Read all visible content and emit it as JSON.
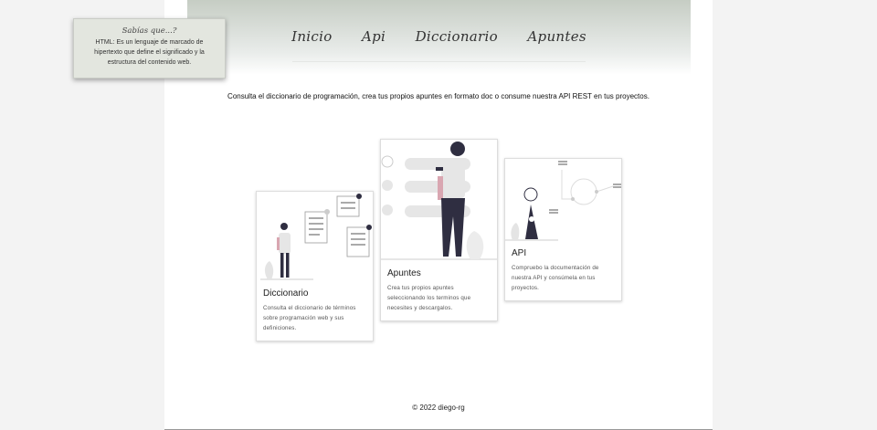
{
  "nav": {
    "items": [
      "Inicio",
      "Api",
      "Diccionario",
      "Apuntes"
    ]
  },
  "tip": {
    "title": "Sabías que...?",
    "text": "HTML: Es un lenguaje de marcado de hipertexto que define el significado y la estructura del contenido web."
  },
  "intro": "Consulta el diccionario de programación, crea tus propios apuntes en formato doc o consume nuestra API REST en tus proyectos.",
  "cards": [
    {
      "title": "Diccionario",
      "description": "Consulta el diccionario de términos sobre programación web y sus definiciones."
    },
    {
      "title": "Apuntes",
      "description": "Crea tus propios apuntes seleccionando los terminos que necesites y descargalos."
    },
    {
      "title": "API",
      "description": "Compruebo la documentación de nuestra API y consúmela en tus proyectos."
    }
  ],
  "footer": "© 2022 diego-rg",
  "colors": {
    "header_top": "#c6cdc4",
    "accent_pink": "#d9a6b1",
    "dark": "#2f2e41",
    "tip_bg": "#e3e6df"
  }
}
